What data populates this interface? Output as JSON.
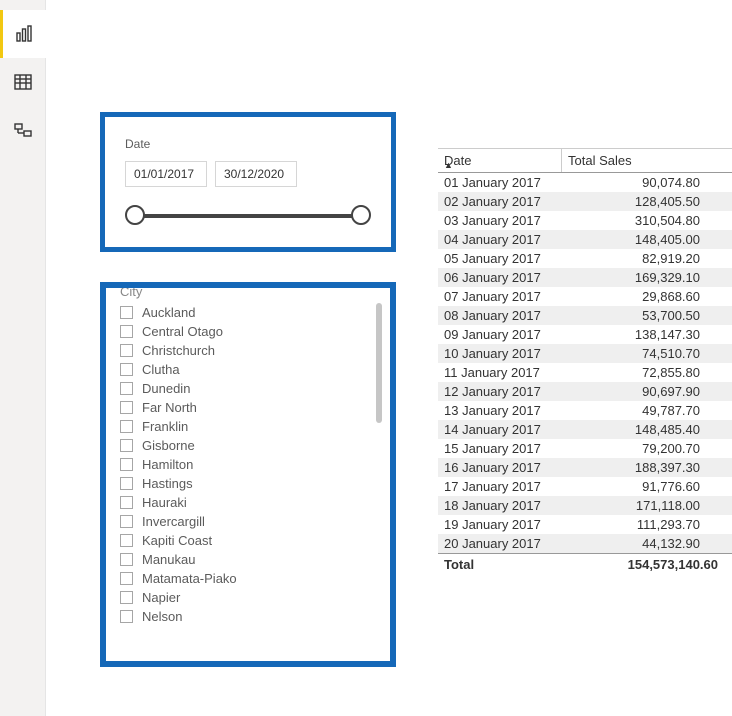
{
  "sidebar": {
    "report_icon": "report",
    "data_icon": "data",
    "model_icon": "model"
  },
  "date_slicer": {
    "title": "Date",
    "start": "01/01/2017",
    "end": "30/12/2020"
  },
  "city_slicer": {
    "title": "City",
    "items": [
      "Auckland",
      "Central Otago",
      "Christchurch",
      "Clutha",
      "Dunedin",
      "Far North",
      "Franklin",
      "Gisborne",
      "Hamilton",
      "Hastings",
      "Hauraki",
      "Invercargill",
      "Kapiti Coast",
      "Manukau",
      "Matamata-Piako",
      "Napier",
      "Nelson"
    ]
  },
  "sales_table": {
    "columns": {
      "date": "Date",
      "total_sales": "Total Sales"
    },
    "rows": [
      {
        "date": "01 January 2017",
        "sales": "90,074.80"
      },
      {
        "date": "02 January 2017",
        "sales": "128,405.50"
      },
      {
        "date": "03 January 2017",
        "sales": "310,504.80"
      },
      {
        "date": "04 January 2017",
        "sales": "148,405.00"
      },
      {
        "date": "05 January 2017",
        "sales": "82,919.20"
      },
      {
        "date": "06 January 2017",
        "sales": "169,329.10"
      },
      {
        "date": "07 January 2017",
        "sales": "29,868.60"
      },
      {
        "date": "08 January 2017",
        "sales": "53,700.50"
      },
      {
        "date": "09 January 2017",
        "sales": "138,147.30"
      },
      {
        "date": "10 January 2017",
        "sales": "74,510.70"
      },
      {
        "date": "11 January 2017",
        "sales": "72,855.80"
      },
      {
        "date": "12 January 2017",
        "sales": "90,697.90"
      },
      {
        "date": "13 January 2017",
        "sales": "49,787.70"
      },
      {
        "date": "14 January 2017",
        "sales": "148,485.40"
      },
      {
        "date": "15 January 2017",
        "sales": "79,200.70"
      },
      {
        "date": "16 January 2017",
        "sales": "188,397.30"
      },
      {
        "date": "17 January 2017",
        "sales": "91,776.60"
      },
      {
        "date": "18 January 2017",
        "sales": "171,118.00"
      },
      {
        "date": "19 January 2017",
        "sales": "111,293.70"
      },
      {
        "date": "20 January 2017",
        "sales": "44,132.90"
      }
    ],
    "total_label": "Total",
    "total_value": "154,573,140.60"
  }
}
